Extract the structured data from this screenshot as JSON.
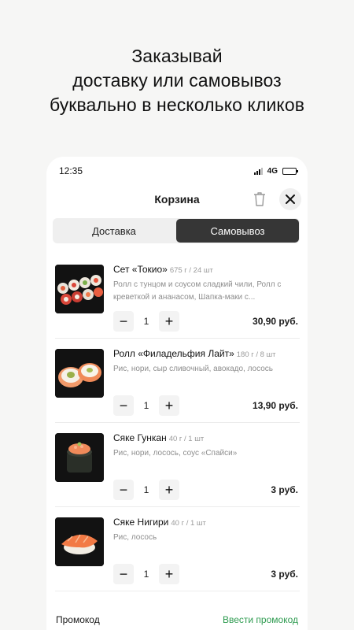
{
  "headline": {
    "line1": "Заказывай",
    "line2": "доставку или самовывоз",
    "line3": "буквально в несколько кликов"
  },
  "status": {
    "time": "12:35",
    "network": "4G"
  },
  "header": {
    "title": "Корзина"
  },
  "tabs": [
    {
      "label": "Доставка",
      "active": false
    },
    {
      "label": "Самовывоз",
      "active": true
    }
  ],
  "items": [
    {
      "name": "Сет «Токио»",
      "meta": "675 г / 24 шт",
      "description": "Ролл с тунцом и соусом сладкий чили, Ролл с креветкой и ананасом, Шапка-маки с...",
      "quantity": "1",
      "price": "30,90 руб."
    },
    {
      "name": "Ролл «Филадельфия Лайт»",
      "meta": "180 г / 8 шт",
      "description": "Рис, нори, сыр сливочный, авокадо, лосось",
      "quantity": "1",
      "price": "13,90 руб."
    },
    {
      "name": "Сяке Гункан",
      "meta": "40 г / 1 шт",
      "description": "Рис, нори, лосось, соус «Спайси»",
      "quantity": "1",
      "price": "3 руб."
    },
    {
      "name": "Сяке Нигири",
      "meta": "40 г / 1 шт",
      "description": "Рис, лосось",
      "quantity": "1",
      "price": "3 руб."
    }
  ],
  "promo": {
    "label": "Промокод",
    "action": "Ввести промокод"
  },
  "colors": {
    "accent_green": "#2e9b50",
    "active_tab": "#363636"
  }
}
